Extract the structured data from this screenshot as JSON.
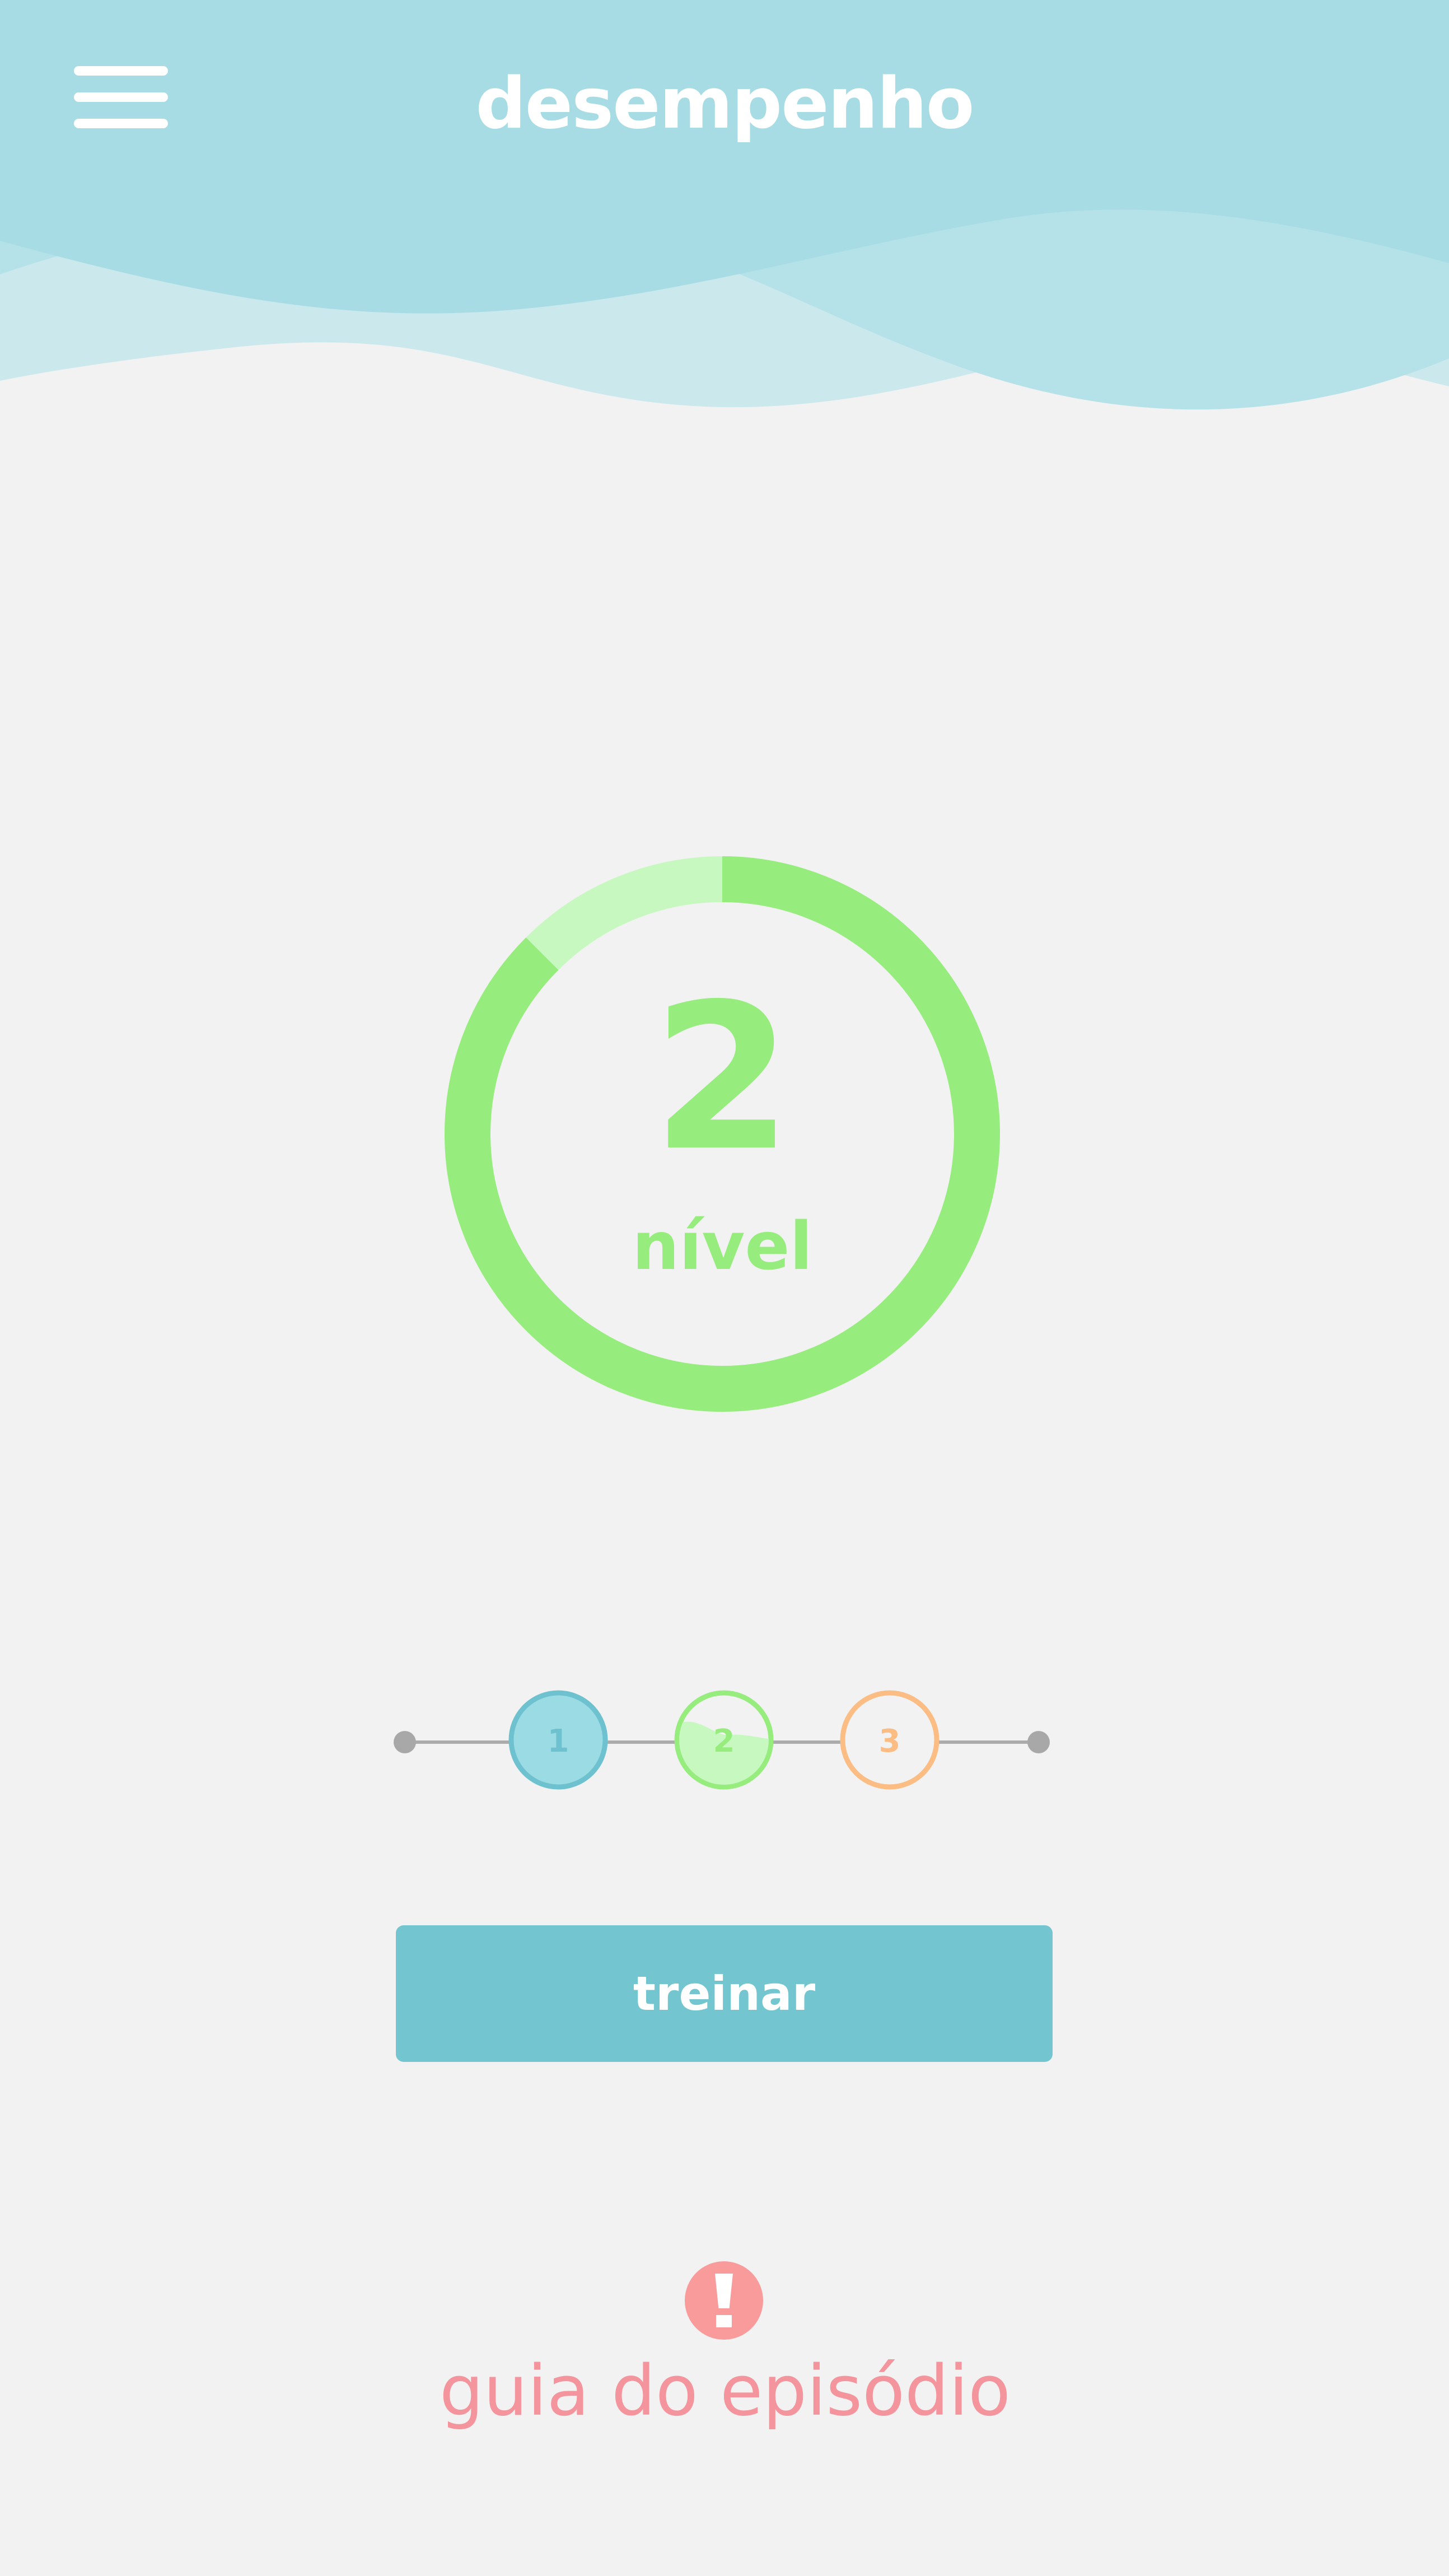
{
  "header": {
    "title": "desempenho",
    "menu_icon": "hamburger-menu-icon",
    "wave_colors": [
      "#a5dce4",
      "#b5e1e8",
      "#c7e7ec"
    ]
  },
  "level": {
    "number": "2",
    "label": "nível",
    "progress": 0.875,
    "ring_color": "#97ec7e",
    "ring_track_color": "#c6f8c0"
  },
  "stepper": {
    "steps": [
      {
        "label": "1",
        "color": "#9adbe4",
        "border": "#6ec2cf",
        "state": "completed"
      },
      {
        "label": "2",
        "color": "#c6f8c0",
        "border": "#97ec7e",
        "state": "current"
      },
      {
        "label": "3",
        "color": "#f2f2f2",
        "border": "#fbbd84",
        "state": "locked"
      }
    ]
  },
  "train_button": {
    "label": "treinar",
    "color": "#73c6cf"
  },
  "guide": {
    "label": "guia do episódio",
    "icon": "alert-exclamation-icon",
    "color": "#f99a9b"
  }
}
